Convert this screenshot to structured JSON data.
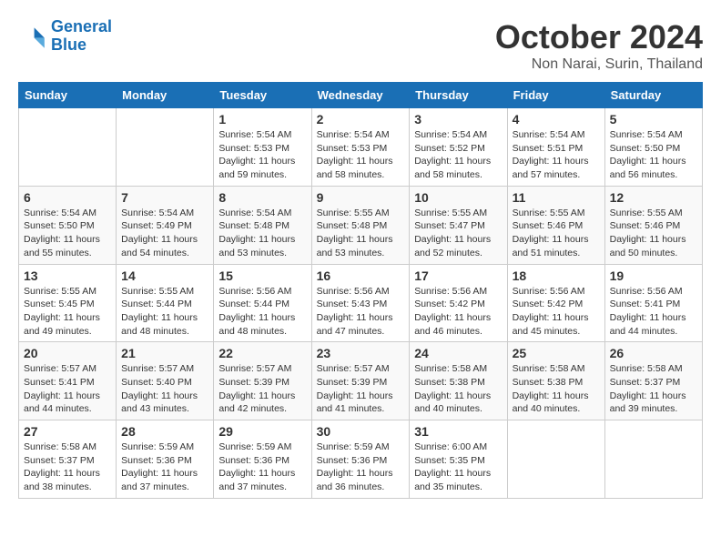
{
  "header": {
    "logo_line1": "General",
    "logo_line2": "Blue",
    "month": "October 2024",
    "location": "Non Narai, Surin, Thailand"
  },
  "weekdays": [
    "Sunday",
    "Monday",
    "Tuesday",
    "Wednesday",
    "Thursday",
    "Friday",
    "Saturday"
  ],
  "weeks": [
    [
      {
        "day": "",
        "info": ""
      },
      {
        "day": "",
        "info": ""
      },
      {
        "day": "1",
        "info": "Sunrise: 5:54 AM\nSunset: 5:53 PM\nDaylight: 11 hours and 59 minutes."
      },
      {
        "day": "2",
        "info": "Sunrise: 5:54 AM\nSunset: 5:53 PM\nDaylight: 11 hours and 58 minutes."
      },
      {
        "day": "3",
        "info": "Sunrise: 5:54 AM\nSunset: 5:52 PM\nDaylight: 11 hours and 58 minutes."
      },
      {
        "day": "4",
        "info": "Sunrise: 5:54 AM\nSunset: 5:51 PM\nDaylight: 11 hours and 57 minutes."
      },
      {
        "day": "5",
        "info": "Sunrise: 5:54 AM\nSunset: 5:50 PM\nDaylight: 11 hours and 56 minutes."
      }
    ],
    [
      {
        "day": "6",
        "info": "Sunrise: 5:54 AM\nSunset: 5:50 PM\nDaylight: 11 hours and 55 minutes."
      },
      {
        "day": "7",
        "info": "Sunrise: 5:54 AM\nSunset: 5:49 PM\nDaylight: 11 hours and 54 minutes."
      },
      {
        "day": "8",
        "info": "Sunrise: 5:54 AM\nSunset: 5:48 PM\nDaylight: 11 hours and 53 minutes."
      },
      {
        "day": "9",
        "info": "Sunrise: 5:55 AM\nSunset: 5:48 PM\nDaylight: 11 hours and 53 minutes."
      },
      {
        "day": "10",
        "info": "Sunrise: 5:55 AM\nSunset: 5:47 PM\nDaylight: 11 hours and 52 minutes."
      },
      {
        "day": "11",
        "info": "Sunrise: 5:55 AM\nSunset: 5:46 PM\nDaylight: 11 hours and 51 minutes."
      },
      {
        "day": "12",
        "info": "Sunrise: 5:55 AM\nSunset: 5:46 PM\nDaylight: 11 hours and 50 minutes."
      }
    ],
    [
      {
        "day": "13",
        "info": "Sunrise: 5:55 AM\nSunset: 5:45 PM\nDaylight: 11 hours and 49 minutes."
      },
      {
        "day": "14",
        "info": "Sunrise: 5:55 AM\nSunset: 5:44 PM\nDaylight: 11 hours and 48 minutes."
      },
      {
        "day": "15",
        "info": "Sunrise: 5:56 AM\nSunset: 5:44 PM\nDaylight: 11 hours and 48 minutes."
      },
      {
        "day": "16",
        "info": "Sunrise: 5:56 AM\nSunset: 5:43 PM\nDaylight: 11 hours and 47 minutes."
      },
      {
        "day": "17",
        "info": "Sunrise: 5:56 AM\nSunset: 5:42 PM\nDaylight: 11 hours and 46 minutes."
      },
      {
        "day": "18",
        "info": "Sunrise: 5:56 AM\nSunset: 5:42 PM\nDaylight: 11 hours and 45 minutes."
      },
      {
        "day": "19",
        "info": "Sunrise: 5:56 AM\nSunset: 5:41 PM\nDaylight: 11 hours and 44 minutes."
      }
    ],
    [
      {
        "day": "20",
        "info": "Sunrise: 5:57 AM\nSunset: 5:41 PM\nDaylight: 11 hours and 44 minutes."
      },
      {
        "day": "21",
        "info": "Sunrise: 5:57 AM\nSunset: 5:40 PM\nDaylight: 11 hours and 43 minutes."
      },
      {
        "day": "22",
        "info": "Sunrise: 5:57 AM\nSunset: 5:39 PM\nDaylight: 11 hours and 42 minutes."
      },
      {
        "day": "23",
        "info": "Sunrise: 5:57 AM\nSunset: 5:39 PM\nDaylight: 11 hours and 41 minutes."
      },
      {
        "day": "24",
        "info": "Sunrise: 5:58 AM\nSunset: 5:38 PM\nDaylight: 11 hours and 40 minutes."
      },
      {
        "day": "25",
        "info": "Sunrise: 5:58 AM\nSunset: 5:38 PM\nDaylight: 11 hours and 40 minutes."
      },
      {
        "day": "26",
        "info": "Sunrise: 5:58 AM\nSunset: 5:37 PM\nDaylight: 11 hours and 39 minutes."
      }
    ],
    [
      {
        "day": "27",
        "info": "Sunrise: 5:58 AM\nSunset: 5:37 PM\nDaylight: 11 hours and 38 minutes."
      },
      {
        "day": "28",
        "info": "Sunrise: 5:59 AM\nSunset: 5:36 PM\nDaylight: 11 hours and 37 minutes."
      },
      {
        "day": "29",
        "info": "Sunrise: 5:59 AM\nSunset: 5:36 PM\nDaylight: 11 hours and 37 minutes."
      },
      {
        "day": "30",
        "info": "Sunrise: 5:59 AM\nSunset: 5:36 PM\nDaylight: 11 hours and 36 minutes."
      },
      {
        "day": "31",
        "info": "Sunrise: 6:00 AM\nSunset: 5:35 PM\nDaylight: 11 hours and 35 minutes."
      },
      {
        "day": "",
        "info": ""
      },
      {
        "day": "",
        "info": ""
      }
    ]
  ]
}
